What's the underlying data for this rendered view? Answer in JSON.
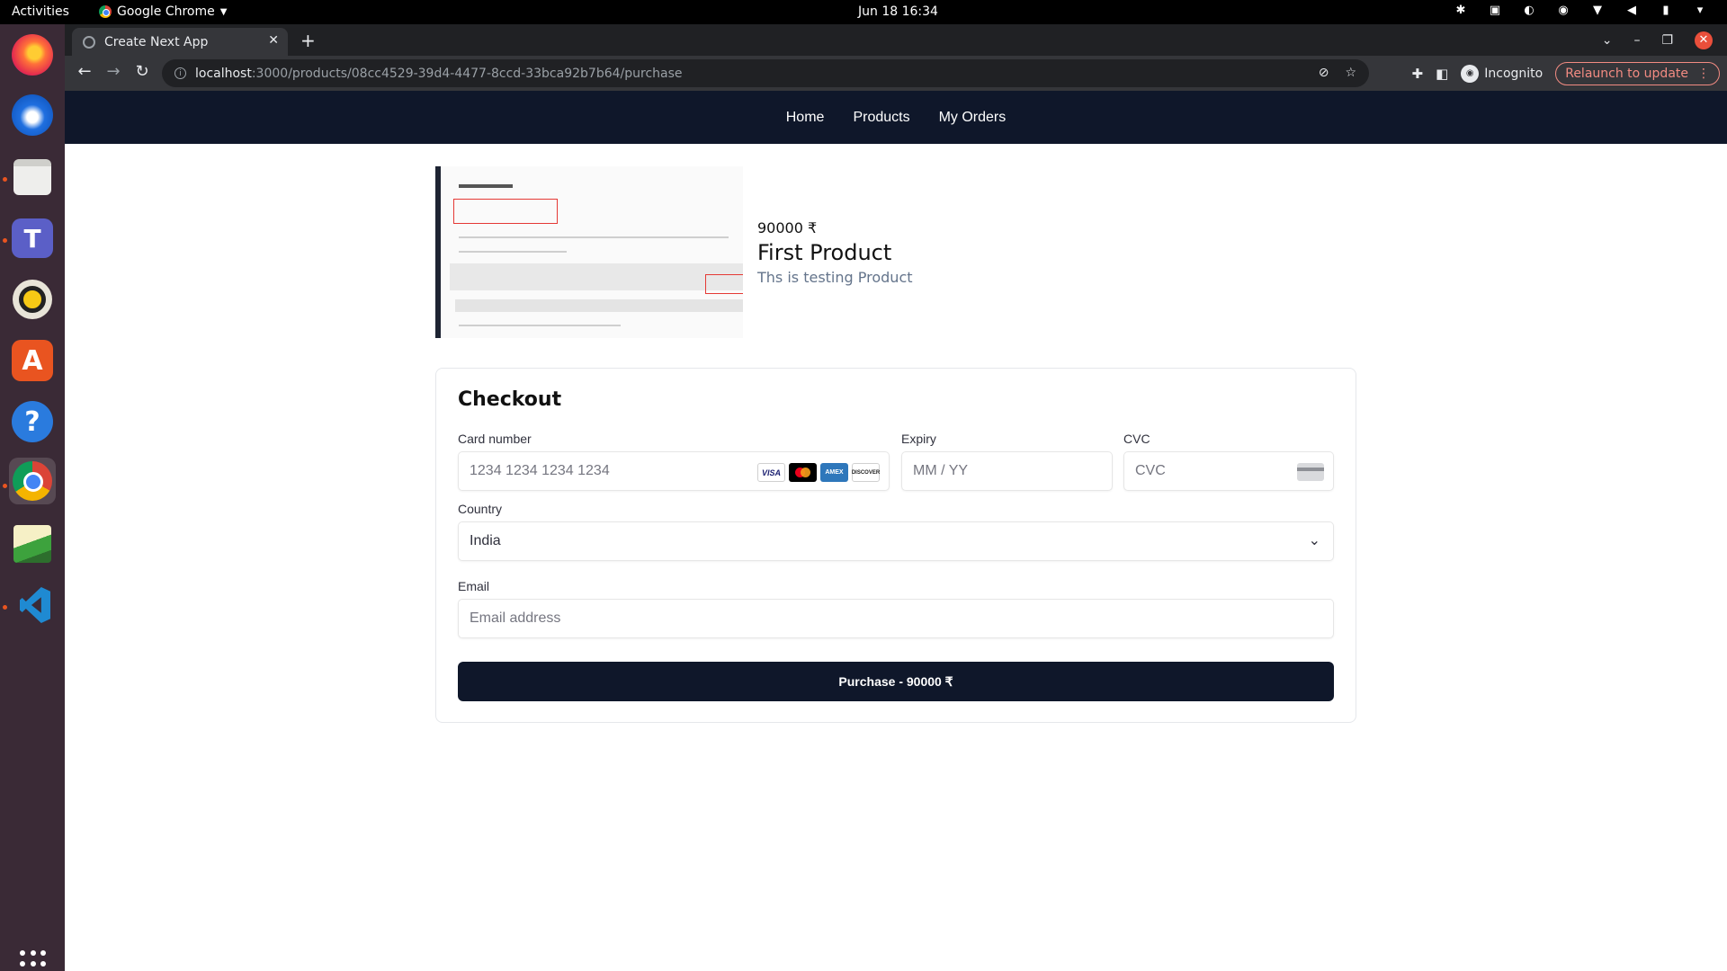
{
  "system": {
    "activities": "Activities",
    "app_name": "Google Chrome",
    "clock": "Jun 18  16:34"
  },
  "dock": {
    "items": [
      "firefox-icon",
      "thunderbird-icon",
      "files-icon",
      "teams-icon",
      "rhythmbox-icon",
      "app-store-icon",
      "help-icon",
      "chrome-icon",
      "image-viewer-icon",
      "vscode-icon",
      "show-apps-icon"
    ]
  },
  "browser": {
    "tab_title": "Create Next App",
    "url_host": "localhost",
    "url_path": ":3000/products/08cc4529-39d4-4477-8ccd-33bca92b7b64/purchase",
    "profile_label": "Incognito",
    "relaunch_label": "Relaunch to update"
  },
  "nav": {
    "home": "Home",
    "products": "Products",
    "orders": "My Orders"
  },
  "product": {
    "price": "90000 ₹",
    "name": "First Product",
    "description": "Ths is testing Product"
  },
  "checkout": {
    "title": "Checkout",
    "card_label": "Card number",
    "card_placeholder": "1234 1234 1234 1234",
    "expiry_label": "Expiry",
    "expiry_placeholder": "MM / YY",
    "cvc_label": "CVC",
    "cvc_placeholder": "CVC",
    "country_label": "Country",
    "country_value": "India",
    "email_label": "Email",
    "email_placeholder": "Email address",
    "purchase_button": "Purchase - 90000 ₹",
    "card_brands": [
      "VISA",
      "mastercard",
      "AMEX",
      "DISCOVER"
    ]
  },
  "colors": {
    "nav_bg": "#0f172a",
    "button_bg": "#0f172a",
    "desc_text": "#64748b"
  }
}
